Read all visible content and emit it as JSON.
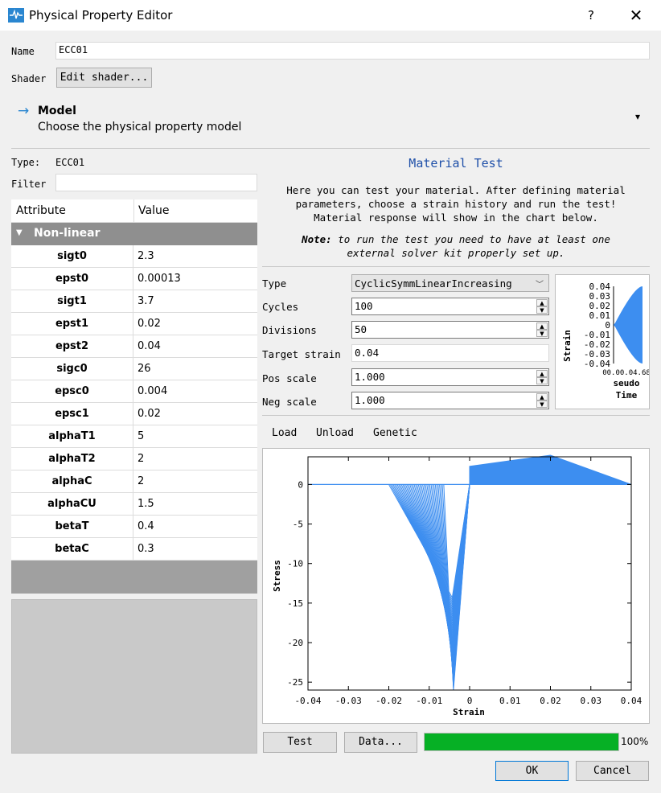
{
  "window": {
    "title": "Physical Property Editor",
    "help": "?",
    "close": "✕",
    "app_icon": "stko-logo-icon"
  },
  "form": {
    "name_label": "Name",
    "name_value": "ECC01",
    "shader_label": "Shader",
    "shader_button": "Edit shader..."
  },
  "model": {
    "title": "Model",
    "subtitle": "Choose the physical property model",
    "arrow": "→",
    "dropdown": "▾"
  },
  "left": {
    "type_label": "Type:",
    "type_value": "ECC01",
    "filter_label": "Filter",
    "filter_value": "",
    "col_attribute": "Attribute",
    "col_value": "Value",
    "group": "Non-linear",
    "rows": [
      {
        "name": "sigt0",
        "value": "2.3"
      },
      {
        "name": "epst0",
        "value": "0.00013"
      },
      {
        "name": "sigt1",
        "value": "3.7"
      },
      {
        "name": "epst1",
        "value": "0.02"
      },
      {
        "name": "epst2",
        "value": "0.04"
      },
      {
        "name": "sigc0",
        "value": "26"
      },
      {
        "name": "epsc0",
        "value": "0.004"
      },
      {
        "name": "epsc1",
        "value": "0.02"
      },
      {
        "name": "alphaT1",
        "value": "5"
      },
      {
        "name": "alphaT2",
        "value": "2"
      },
      {
        "name": "alphaC",
        "value": "2"
      },
      {
        "name": "alphaCU",
        "value": "1.5"
      },
      {
        "name": "betaT",
        "value": "0.4"
      },
      {
        "name": "betaC",
        "value": "0.3"
      }
    ]
  },
  "test": {
    "heading": "Material Test",
    "desc1": "Here you can test your material. After defining material",
    "desc2": "parameters, choose a strain history and run the test!",
    "desc3": "Material response will show in the chart below.",
    "note_bold": "Note:",
    "note1": " to run the test you need to have at least one",
    "note2": "external solver kit properly set up.",
    "type_label": "Type",
    "type_value": "CyclicSymmLinearIncreasing",
    "cycles_label": "Cycles",
    "cycles_value": "100",
    "divisions_label": "Divisions",
    "divisions_value": "50",
    "target_label": "Target strain",
    "target_value": "0.04",
    "pos_label": "Pos scale",
    "pos_value": "1.000",
    "neg_label": "Neg scale",
    "neg_value": "1.000",
    "tabs": [
      "Load",
      "Unload",
      "Genetic"
    ],
    "test_button": "Test",
    "data_button": "Data...",
    "progress": 100,
    "progress_label": "100%"
  },
  "footer": {
    "ok": "OK",
    "cancel": "Cancel"
  },
  "chart_data": [
    {
      "type": "area",
      "xlabel": "Pseudo Time",
      "ylabel": "Strain",
      "y_ticks": [
        "0.04",
        "0.03",
        "0.02",
        "0.01",
        "0",
        "-0.01",
        "-0.02",
        "-0.03",
        "-0.04"
      ],
      "x_ticks_text": "00.00.04.68",
      "xlabel_visible": "seudo",
      "xlabel2_visible": "Time",
      "ylim": [
        -0.04,
        0.04
      ],
      "color": "#3d8ef0"
    },
    {
      "type": "line",
      "xlabel": "Strain",
      "ylabel": "Stress",
      "xlim": [
        -0.04,
        0.04
      ],
      "ylim": [
        -26,
        3.5
      ],
      "x_ticks": [
        "-0.04",
        "-0.03",
        "-0.02",
        "-0.01",
        "0",
        "0.01",
        "0.02",
        "0.03",
        "0.04"
      ],
      "y_ticks": [
        "0",
        "-5",
        "-10",
        "-15",
        "-20",
        "-25"
      ],
      "color": "#3d8ef0",
      "compression_peak": {
        "strain": -0.004,
        "stress": -26
      },
      "tension_peak": {
        "strain": 0.02,
        "stress": 3.7
      },
      "tension_start": {
        "strain": 0.0,
        "stress": 2.3
      }
    }
  ]
}
